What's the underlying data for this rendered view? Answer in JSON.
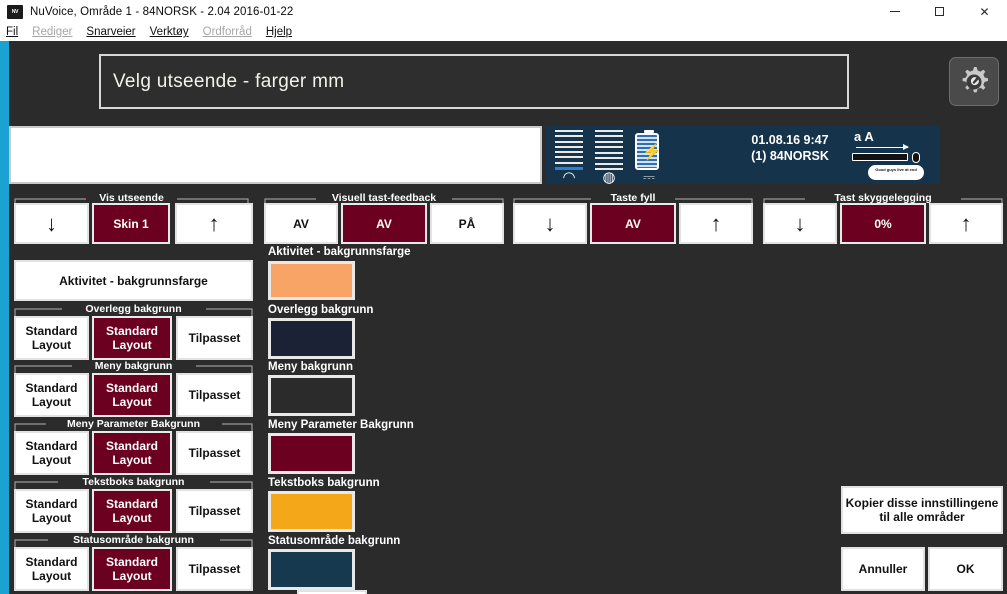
{
  "window": {
    "title": "NuVoice, Område 1 - 84NORSK - 2.04 2016-01-22",
    "icon": "nuvoice-app-icon",
    "minimize": "–",
    "maximize": "□",
    "close": "✕"
  },
  "menu": {
    "items": [
      {
        "label": "Fil",
        "disabled": false
      },
      {
        "label": "Rediger",
        "disabled": true
      },
      {
        "label": "Snarveier",
        "disabled": false
      },
      {
        "label": "Verktøy",
        "disabled": false
      },
      {
        "label": "Ordforråd",
        "disabled": true
      },
      {
        "label": "Hjelp",
        "disabled": false
      }
    ]
  },
  "header": {
    "prompt": "Velg utseende - farger mm",
    "gear_icon": "gear-wrench-icon"
  },
  "text_entry": {
    "value": "",
    "placeholder": ""
  },
  "status_panel": {
    "datetime": "01.08.16 9:47",
    "area": "(1) 84NORSK",
    "icons": [
      "headphone-icon",
      "speaker-icon",
      "battery-charging-icon",
      "power-plug-icon",
      "font-size-icon",
      "keyboard-icon",
      "mouse-icon",
      "speech-bubble-icon",
      "sparkline-icon"
    ],
    "bubble_text": "Good guys live at end",
    "font_labels": "a A"
  },
  "toolbar_groups": [
    {
      "title": "Vis utseende",
      "buttons": [
        {
          "label": "↓",
          "type": "arrow-down",
          "selected": false
        },
        {
          "label": "Skin 1",
          "type": "value",
          "selected": true
        },
        {
          "label": "↑",
          "type": "arrow-up",
          "selected": false
        }
      ]
    },
    {
      "title": "Visuell tast-feedback",
      "buttons": [
        {
          "label": "AV",
          "type": "value",
          "selected": false
        },
        {
          "label": "AV",
          "type": "value",
          "selected": true
        },
        {
          "label": "PÅ",
          "type": "value",
          "selected": false
        }
      ]
    },
    {
      "title": "Taste fyll",
      "buttons": [
        {
          "label": "↓",
          "type": "arrow-down",
          "selected": false
        },
        {
          "label": "AV",
          "type": "value",
          "selected": true
        },
        {
          "label": "↑",
          "type": "arrow-up",
          "selected": false
        }
      ]
    },
    {
      "title": "Tast skyggelegging",
      "buttons": [
        {
          "label": "↓",
          "type": "arrow-down",
          "selected": false
        },
        {
          "label": "0%",
          "type": "value",
          "selected": true
        },
        {
          "label": "↑",
          "type": "arrow-up",
          "selected": false
        }
      ]
    }
  ],
  "activity_button": {
    "label": "Aktivitet - bakgrunnsfarge"
  },
  "color_rows": [
    {
      "group_title": null,
      "swatch_label": "Aktivitet - bakgrunnsfarge",
      "swatch_color": "#f9a467",
      "options": []
    },
    {
      "group_title": "Overlegg bakgrunn",
      "swatch_label": "Overlegg bakgrunn",
      "swatch_color": "#1b2236",
      "options": [
        {
          "label": "Standard Layout",
          "selected": false
        },
        {
          "label": "Standard Layout",
          "selected": true
        },
        {
          "label": "Tilpasset",
          "selected": false
        }
      ]
    },
    {
      "group_title": "Meny bakgrunn",
      "swatch_label": "Meny bakgrunn",
      "swatch_color": "#2b2b2b",
      "options": [
        {
          "label": "Standard Layout",
          "selected": false
        },
        {
          "label": "Standard Layout",
          "selected": true
        },
        {
          "label": "Tilpasset",
          "selected": false
        }
      ]
    },
    {
      "group_title": "Meny Parameter Bakgrunn",
      "swatch_label": "Meny Parameter Bakgrunn",
      "swatch_color": "#6b0020",
      "options": [
        {
          "label": "Standard Layout",
          "selected": false
        },
        {
          "label": "Standard Layout",
          "selected": true
        },
        {
          "label": "Tilpasset",
          "selected": false
        }
      ]
    },
    {
      "group_title": "Tekstboks bakgrunn",
      "swatch_label": "Tekstboks bakgrunn",
      "swatch_color": "#f5a71a",
      "options": [
        {
          "label": "Standard Layout",
          "selected": false
        },
        {
          "label": "Standard Layout",
          "selected": true
        },
        {
          "label": "Tilpasset",
          "selected": false
        }
      ]
    },
    {
      "group_title": "Statusområde bakgrunn",
      "swatch_label": "Statusområde bakgrunn",
      "swatch_color": "#17394f",
      "options": [
        {
          "label": "Standard Layout",
          "selected": false
        },
        {
          "label": "Standard Layout",
          "selected": true
        },
        {
          "label": "Tilpasset",
          "selected": false
        }
      ]
    }
  ],
  "actions": {
    "copy_all": "Kopier disse innstillingene til alle områder",
    "cancel": "Annuller",
    "ok": "OK"
  },
  "colors": {
    "selected_red": "#6b0020",
    "app_background": "#2b2b2b",
    "rail_blue": "#1aa3d2",
    "status_panel": "#16334c"
  }
}
